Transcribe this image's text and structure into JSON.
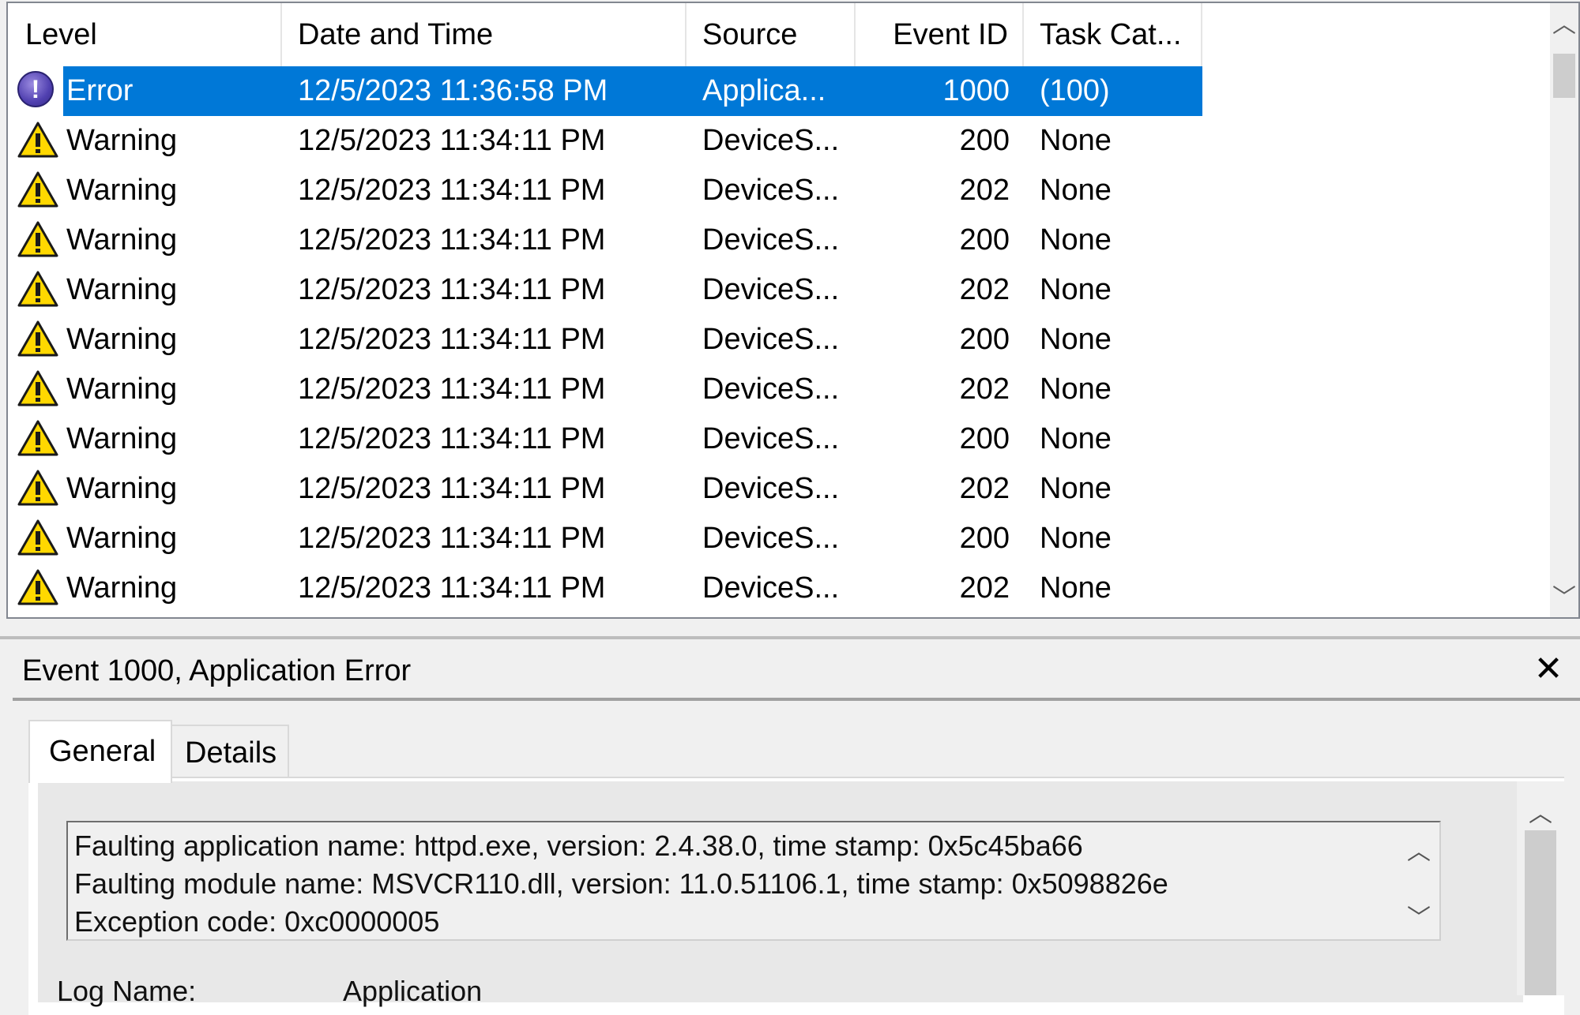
{
  "columns": {
    "level": "Level",
    "date": "Date and Time",
    "source": "Source",
    "event_id": "Event ID",
    "task": "Task Cat..."
  },
  "rows": [
    {
      "type": "error",
      "icon": "error-icon",
      "level": "Error",
      "date": "12/5/2023 11:36:58 PM",
      "source": "Applica...",
      "event_id": "1000",
      "task": "(100)",
      "selected": true
    },
    {
      "type": "warning",
      "icon": "warning-icon",
      "level": "Warning",
      "date": "12/5/2023 11:34:11 PM",
      "source": "DeviceS...",
      "event_id": "200",
      "task": "None"
    },
    {
      "type": "warning",
      "icon": "warning-icon",
      "level": "Warning",
      "date": "12/5/2023 11:34:11 PM",
      "source": "DeviceS...",
      "event_id": "202",
      "task": "None"
    },
    {
      "type": "warning",
      "icon": "warning-icon",
      "level": "Warning",
      "date": "12/5/2023 11:34:11 PM",
      "source": "DeviceS...",
      "event_id": "200",
      "task": "None"
    },
    {
      "type": "warning",
      "icon": "warning-icon",
      "level": "Warning",
      "date": "12/5/2023 11:34:11 PM",
      "source": "DeviceS...",
      "event_id": "202",
      "task": "None"
    },
    {
      "type": "warning",
      "icon": "warning-icon",
      "level": "Warning",
      "date": "12/5/2023 11:34:11 PM",
      "source": "DeviceS...",
      "event_id": "200",
      "task": "None"
    },
    {
      "type": "warning",
      "icon": "warning-icon",
      "level": "Warning",
      "date": "12/5/2023 11:34:11 PM",
      "source": "DeviceS...",
      "event_id": "202",
      "task": "None"
    },
    {
      "type": "warning",
      "icon": "warning-icon",
      "level": "Warning",
      "date": "12/5/2023 11:34:11 PM",
      "source": "DeviceS...",
      "event_id": "200",
      "task": "None"
    },
    {
      "type": "warning",
      "icon": "warning-icon",
      "level": "Warning",
      "date": "12/5/2023 11:34:11 PM",
      "source": "DeviceS...",
      "event_id": "202",
      "task": "None"
    },
    {
      "type": "warning",
      "icon": "warning-icon",
      "level": "Warning",
      "date": "12/5/2023 11:34:11 PM",
      "source": "DeviceS...",
      "event_id": "200",
      "task": "None"
    },
    {
      "type": "warning",
      "icon": "warning-icon",
      "level": "Warning",
      "date": "12/5/2023 11:34:11 PM",
      "source": "DeviceS...",
      "event_id": "202",
      "task": "None"
    }
  ],
  "detail": {
    "title": "Event 1000, Application Error",
    "tabs": {
      "general": "General",
      "details": "Details"
    },
    "description_lines": [
      "Faulting application name: httpd.exe, version: 2.4.38.0, time stamp: 0x5c45ba66",
      "Faulting module name: MSVCR110.dll, version: 11.0.51106.1, time stamp: 0x5098826e",
      "Exception code: 0xc0000005"
    ],
    "cut_label": "Log Name:",
    "cut_value": "Application"
  },
  "colors": {
    "selection": "#0078d7",
    "warning_yellow": "#ffd800",
    "error_purple": "#5040b0"
  }
}
